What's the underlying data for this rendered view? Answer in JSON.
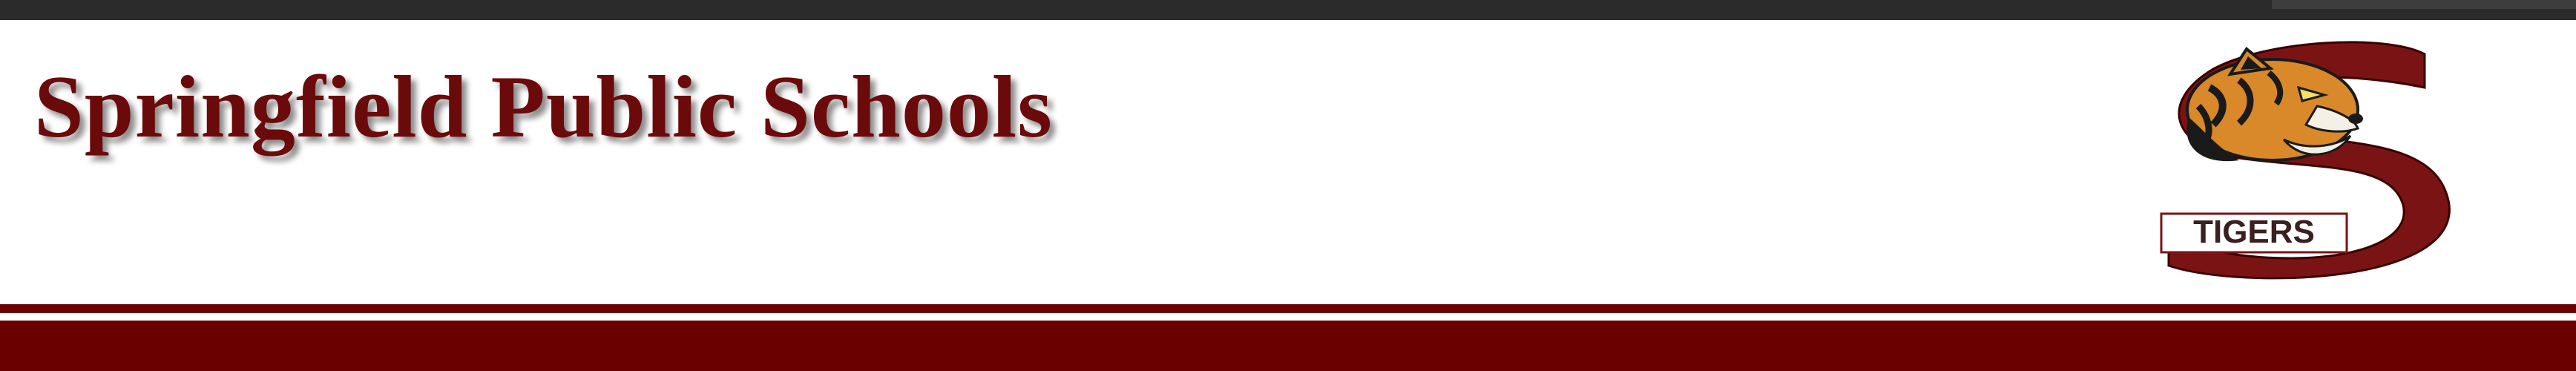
{
  "header": {
    "title": "Springfield Public Schools"
  },
  "logo": {
    "letter": "S",
    "text": "TIGERS",
    "icon": "tiger-mascot-icon"
  },
  "colors": {
    "maroon": "#6b0000",
    "title": "#6b0a0a",
    "tiger_orange": "#d9892a",
    "top_bar": "#2b2b2b"
  }
}
